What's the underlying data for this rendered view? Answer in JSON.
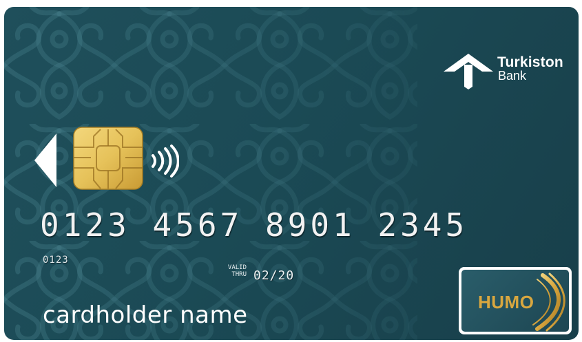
{
  "bank": {
    "name": "Turkiston",
    "subtitle": "Bank"
  },
  "card": {
    "number": "0123 4567 8901 2345",
    "short_number": "0123",
    "valid_thru_label": "VALID THRU",
    "valid_label_line1": "VALID",
    "valid_label_line2": "THRU",
    "expiry": "02/20",
    "holder": "cardholder name"
  },
  "network": {
    "name": "HUMO"
  },
  "colors": {
    "card_background": "#1f4f5b",
    "pattern": "#3a6f7a",
    "chip_gold": "#e6c25a",
    "humo_gold": "#d9a73f",
    "text": "#ffffff"
  },
  "icons": [
    "bank-logo-icon",
    "card-marker-icon",
    "emv-chip-icon",
    "contactless-icon",
    "humo-swoosh-icon"
  ]
}
